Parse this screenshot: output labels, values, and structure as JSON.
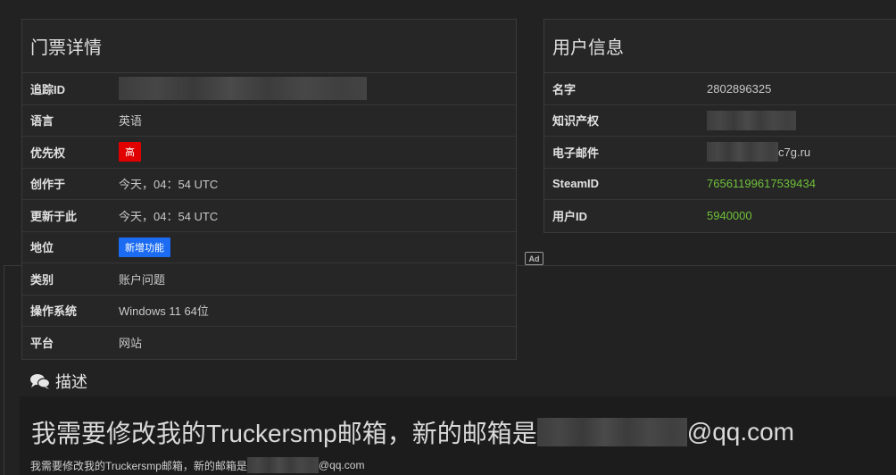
{
  "ticket": {
    "title": "门票详情",
    "rows": [
      {
        "label": "追踪ID",
        "value": ""
      },
      {
        "label": "语言",
        "value": "英语"
      },
      {
        "label": "优先权",
        "value": "高"
      },
      {
        "label": "创作于",
        "value": "今天，04：54 UTC"
      },
      {
        "label": "更新于此",
        "value": "今天，04：54 UTC"
      },
      {
        "label": "地位",
        "value": "新增功能"
      },
      {
        "label": "类别",
        "value": "账户问题"
      },
      {
        "label": "操作系统",
        "value": "Windows 11 64位"
      },
      {
        "label": "平台",
        "value": "网站"
      }
    ],
    "priority_color": "#e00000",
    "status_color": "#1b6cf2"
  },
  "user": {
    "title": "用户信息",
    "rows": [
      {
        "label": "名字",
        "value": "2802896325"
      },
      {
        "label": "知识产权",
        "value": ""
      },
      {
        "label": "电子邮件",
        "value": "c7g.ru"
      },
      {
        "label": "SteamID",
        "value": "76561199617539434"
      },
      {
        "label": "用户ID",
        "value": "5940000"
      }
    ],
    "link_color": "#6fc13a"
  },
  "ad_label": "Ad",
  "description": {
    "icon": "comments-icon",
    "title": "描述",
    "big_prefix": "我需要修改我的Truckersmp邮箱，新的邮箱是",
    "big_suffix": "@qq.com",
    "small_prefix": "我需要修改我的Truckersmp邮箱，新的邮箱是",
    "small_suffix": "@qq.com"
  }
}
